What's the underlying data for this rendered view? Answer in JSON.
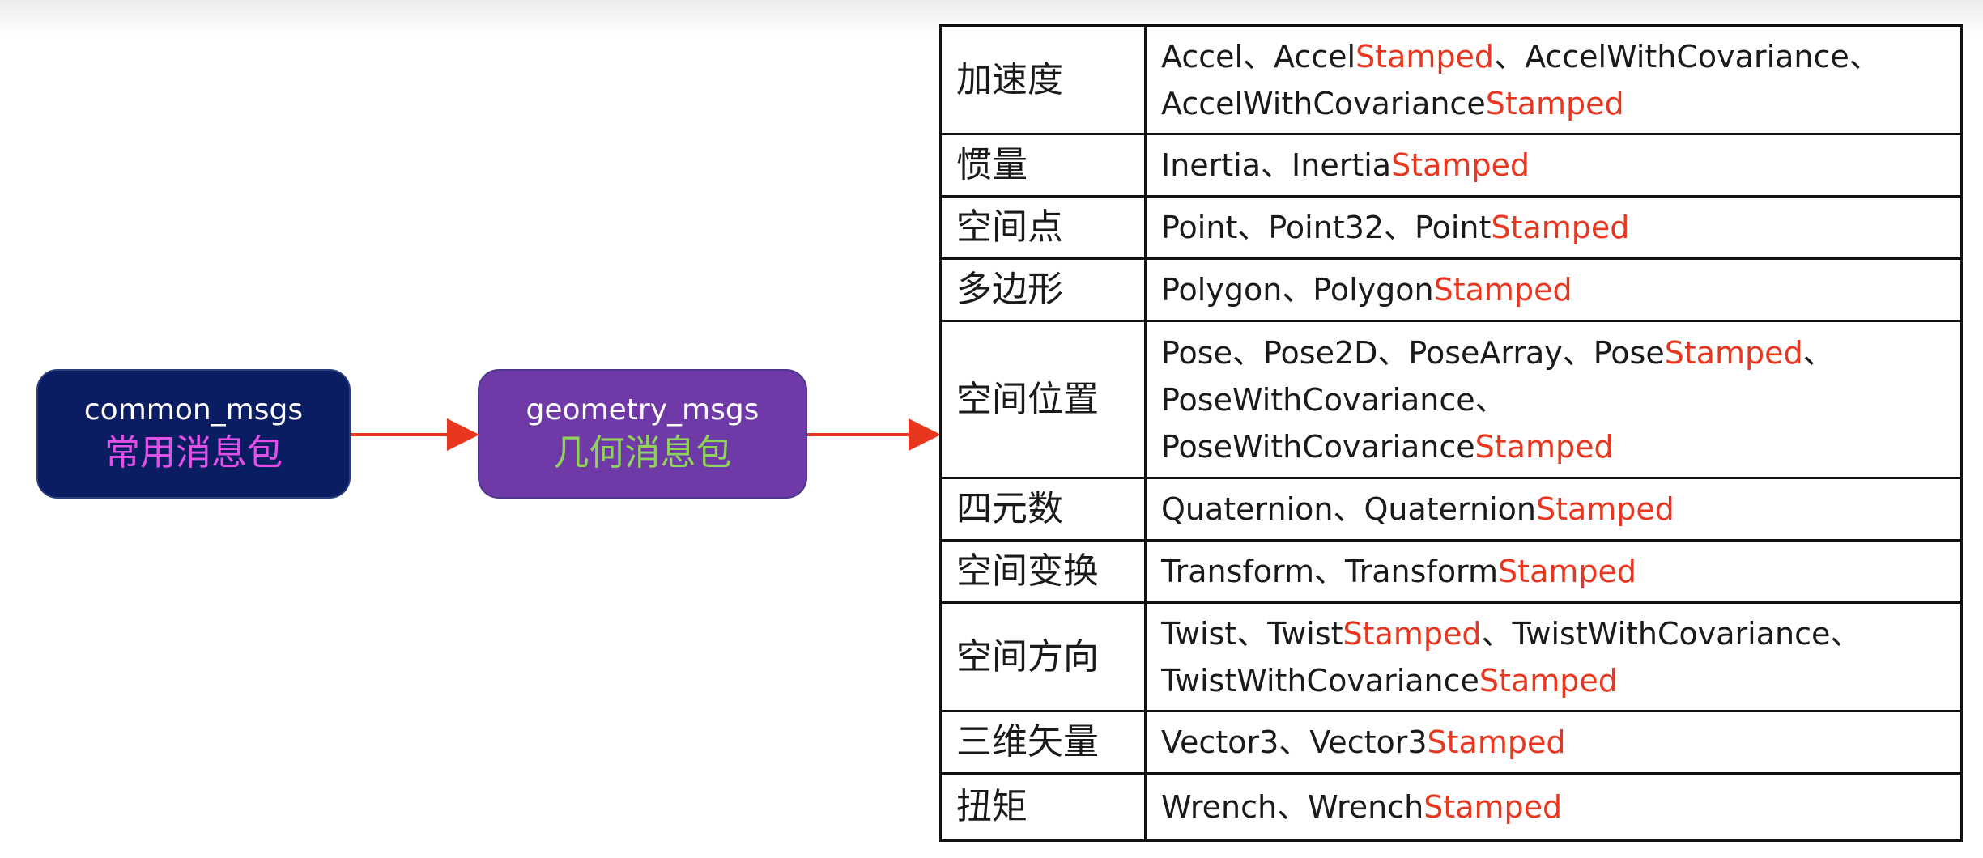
{
  "boxes": {
    "common": {
      "title": "common_msgs",
      "subtitle": "常用消息包"
    },
    "geometry": {
      "title": "geometry_msgs",
      "subtitle": "几何消息包"
    }
  },
  "colors": {
    "common_fill": "#0b1d62",
    "geometry_fill": "#7039a8",
    "common_subtitle": "#e050e6",
    "geometry_subtitle": "#8fd35a",
    "arrow": "#e8361f",
    "stamped": "#e8361f"
  },
  "table": {
    "rows": [
      {
        "category": "加速度",
        "lines": [
          [
            [
              "Accel、Accel",
              false
            ],
            [
              "Stamped",
              true
            ],
            [
              "、AccelWithCovariance、",
              false
            ]
          ],
          [
            [
              "AccelWithCovariance",
              false
            ],
            [
              "Stamped",
              true
            ]
          ]
        ]
      },
      {
        "category": "惯量",
        "lines": [
          [
            [
              "Inertia、Inertia",
              false
            ],
            [
              "Stamped",
              true
            ]
          ]
        ]
      },
      {
        "category": "空间点",
        "lines": [
          [
            [
              "Point、Point32、Point",
              false
            ],
            [
              "Stamped",
              true
            ]
          ]
        ]
      },
      {
        "category": "多边形",
        "lines": [
          [
            [
              "Polygon、Polygon",
              false
            ],
            [
              "Stamped",
              true
            ]
          ]
        ]
      },
      {
        "category": "空间位置",
        "lines": [
          [
            [
              "Pose、Pose2D、PoseArray、Pose",
              false
            ],
            [
              "Stamped",
              true
            ],
            [
              "、",
              false
            ]
          ],
          [
            [
              "PoseWithCovariance、",
              false
            ]
          ],
          [
            [
              "PoseWithCovariance",
              false
            ],
            [
              "Stamped",
              true
            ]
          ]
        ]
      },
      {
        "category": "四元数",
        "lines": [
          [
            [
              "Quaternion、Quaternion",
              false
            ],
            [
              "Stamped",
              true
            ]
          ]
        ]
      },
      {
        "category": "空间变换",
        "lines": [
          [
            [
              "Transform、Transform",
              false
            ],
            [
              "Stamped",
              true
            ]
          ]
        ]
      },
      {
        "category": "空间方向",
        "lines": [
          [
            [
              "Twist、Twist",
              false
            ],
            [
              "Stamped",
              true
            ],
            [
              "、TwistWithCovariance、",
              false
            ]
          ],
          [
            [
              "TwistWithCovariance",
              false
            ],
            [
              "Stamped",
              true
            ]
          ]
        ]
      },
      {
        "category": "三维矢量",
        "lines": [
          [
            [
              "Vector3、Vector3",
              false
            ],
            [
              "Stamped",
              true
            ]
          ]
        ]
      },
      {
        "category": "扭矩",
        "lines": [
          [
            [
              "Wrench、Wrench",
              false
            ],
            [
              "Stamped",
              true
            ]
          ]
        ]
      }
    ]
  }
}
